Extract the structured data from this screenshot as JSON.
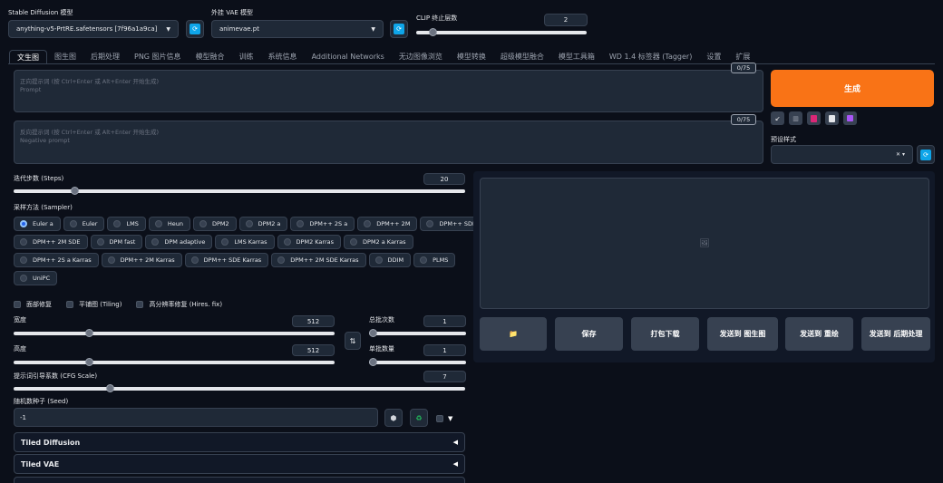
{
  "top": {
    "model_label": "Stable Diffusion 模型",
    "model_value": "anything-v5-PrtRE.safetensors [7f96a1a9ca]",
    "vae_label": "外挂 VAE 模型",
    "vae_value": "animevae.pt",
    "clip_label": "CLIP 终止层数",
    "clip_value": "2",
    "refresh_icon": "refresh-icon"
  },
  "tabs": [
    "文生图",
    "图生图",
    "后期处理",
    "PNG 图片信息",
    "模型融合",
    "训练",
    "系统信息",
    "Additional Networks",
    "无边图像浏览",
    "模型转换",
    "超级模型融合",
    "模型工具箱",
    "WD 1.4 标签器 (Tagger)",
    "设置",
    "扩展"
  ],
  "prompt": {
    "placeholder_cn": "正向提示词 (按 Ctrl+Enter 或 Alt+Enter 开始生成)",
    "placeholder_en": "Prompt",
    "counter": "0/75"
  },
  "neg_prompt": {
    "placeholder_cn": "反向提示词 (按 Ctrl+Enter 或 Alt+Enter 开始生成)",
    "placeholder_en": "Negative prompt",
    "counter": "0/75"
  },
  "generate_label": "生成",
  "tool_icons": [
    "arrow-icon",
    "trash-icon",
    "pink-card-icon",
    "clipboard-icon",
    "save-icon"
  ],
  "styles_label": "预设样式",
  "steps": {
    "label": "迭代步数 (Steps)",
    "value": "20",
    "level": 0.13
  },
  "sampler": {
    "label": "采样方法 (Sampler)",
    "selected": "Euler a",
    "rows": [
      [
        "Euler a",
        "Euler",
        "LMS",
        "Heun",
        "DPM2",
        "DPM2 a",
        "DPM++ 2S a",
        "DPM++ 2M",
        "DPM++ SDE"
      ],
      [
        "DPM++ 2M SDE",
        "DPM fast",
        "DPM adaptive",
        "LMS Karras",
        "DPM2 Karras",
        "DPM2 a Karras"
      ],
      [
        "DPM++ 2S a Karras",
        "DPM++ 2M Karras",
        "DPM++ SDE Karras",
        "DPM++ 2M SDE Karras",
        "DDIM",
        "PLMS"
      ],
      [
        "UniPC"
      ]
    ]
  },
  "checks": [
    "面部修复",
    "平铺图 (Tiling)",
    "高分辨率修复 (Hires. fix)"
  ],
  "width": {
    "label": "宽度",
    "value": "512"
  },
  "height": {
    "label": "高度",
    "value": "512"
  },
  "batch_count": {
    "label": "总批次数",
    "value": "1"
  },
  "batch_size": {
    "label": "单批数量",
    "value": "1"
  },
  "cfg": {
    "label": "提示词引导系数 (CFG Scale)",
    "value": "7"
  },
  "seed": {
    "label": "随机数种子 (Seed)",
    "value": "-1"
  },
  "accordions": [
    "Tiled Diffusion",
    "Tiled VAE"
  ],
  "output_buttons": [
    "保存",
    "打包下载",
    "发送到 图生图",
    "发送到 重绘",
    "发送到 后期处理"
  ],
  "colors": {
    "accent": "#f97316",
    "bg": "#0b0f19",
    "panel": "#1f2937",
    "blue": "#0ea5e9"
  }
}
